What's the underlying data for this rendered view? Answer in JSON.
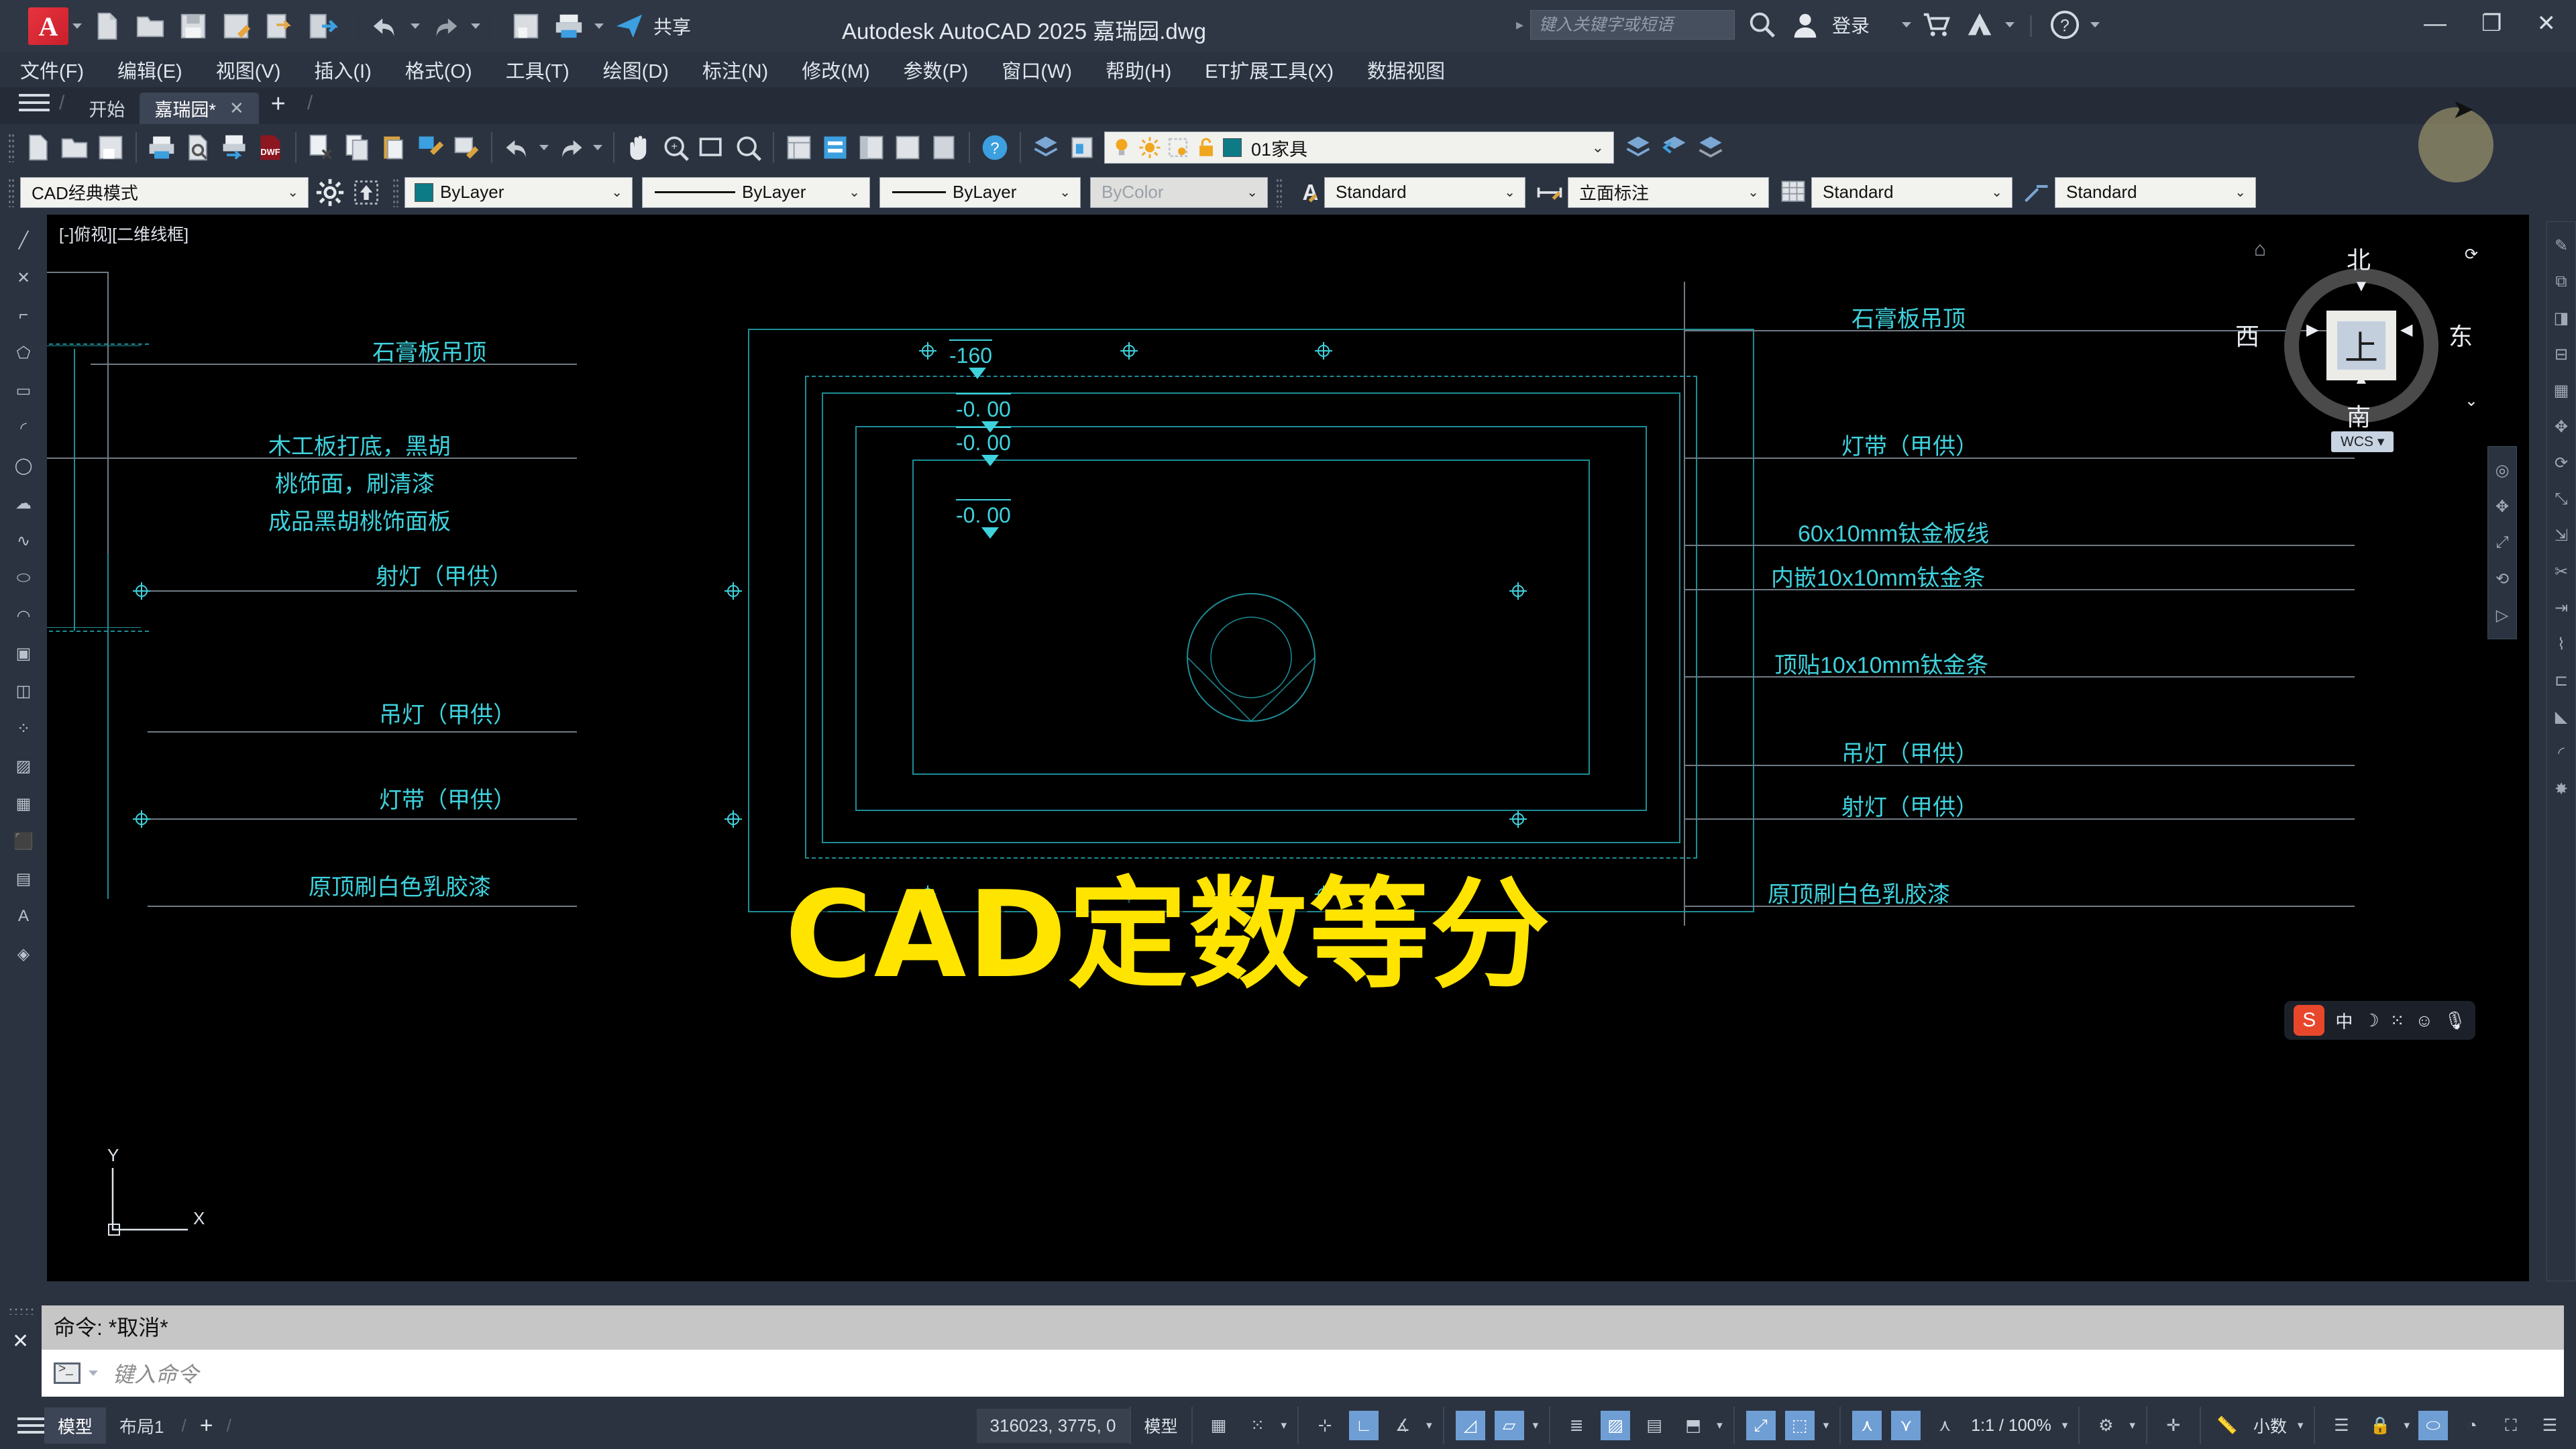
{
  "titlebar": {
    "app_logo": "autocad-A-logo",
    "title": "Autodesk AutoCAD 2025   嘉瑞园.dwg",
    "search_placeholder": "键入关键字或短语",
    "login_label": "登录",
    "quick_access_icons": [
      "new-file-icon",
      "open-folder-icon",
      "save-icon",
      "save-as-icon",
      "export-icon",
      "undo-icon",
      "redo-icon",
      "save-alt-icon",
      "print-icon",
      "share-icon"
    ],
    "share_label": "共享",
    "window_buttons": [
      "minimize",
      "restore",
      "close"
    ]
  },
  "menubar": {
    "items": [
      {
        "label": "文件(F)"
      },
      {
        "label": "编辑(E)"
      },
      {
        "label": "视图(V)"
      },
      {
        "label": "插入(I)"
      },
      {
        "label": "格式(O)"
      },
      {
        "label": "工具(T)"
      },
      {
        "label": "绘图(D)"
      },
      {
        "label": "标注(N)"
      },
      {
        "label": "修改(M)"
      },
      {
        "label": "参数(P)"
      },
      {
        "label": "窗口(W)"
      },
      {
        "label": "帮助(H)"
      },
      {
        "label": "ET扩展工具(X)"
      },
      {
        "label": "数据视图"
      }
    ]
  },
  "tabs": {
    "start_tab": "开始",
    "file_tab": "嘉瑞园*",
    "close_glyph": "✕",
    "plus_glyph": "+"
  },
  "toolbar": {
    "layer_name": "01家具",
    "layer_dropdown_glyph": "⌄"
  },
  "properties": {
    "workspace": "CAD经典模式",
    "color": "ByLayer",
    "linetype": "ByLayer",
    "lineweight": "ByLayer",
    "transparency": "ByColor",
    "text_style": "Standard",
    "dim_style": "立面标注",
    "table_style": "Standard",
    "multileader_style": "Standard"
  },
  "canvas": {
    "viewport_label": "[-]俯视][二维线框]",
    "watermark": "CAD定数等分",
    "left_annotations": [
      "石膏板吊顶",
      "木工板打底，黑胡",
      "桃饰面，刷清漆",
      "成品黑胡桃饰面板",
      "射灯（甲供）",
      "吊灯（甲供）",
      "灯带（甲供）",
      "原顶刷白色乳胶漆"
    ],
    "right_annotations": [
      "石膏板吊顶",
      "灯带（甲供）",
      "60x10mm钛金板线",
      "内嵌10x10mm钛金条",
      "顶贴10x10mm钛金条",
      "吊灯（甲供）",
      "射灯（甲供）",
      "原顶刷白色乳胶漆"
    ],
    "elevations": [
      "-160",
      "-0. 00",
      "-0. 00",
      "-0. 00"
    ],
    "viewcube": {
      "north": "北",
      "south": "南",
      "west": "西",
      "east": "东",
      "top_face": "上",
      "ucs_label": "WCS",
      "home_icon": "home-icon"
    },
    "ucs_axis": {
      "y": "Y",
      "x": "X"
    }
  },
  "commandline": {
    "history": "命令: *取消*",
    "placeholder": "键入命令"
  },
  "statusbar": {
    "model_tab": "模型",
    "layout_tab": "布局1",
    "plus_glyph": "+",
    "coordinates": "316023, 3775, 0",
    "space_label": "模型",
    "scale": "1:1 / 100%",
    "units": "小数",
    "toggles": [
      {
        "name": "grid-display",
        "on": false
      },
      {
        "name": "snap-mode",
        "on": false
      },
      {
        "name": "infer-constraints",
        "on": false
      },
      {
        "name": "ortho-mode",
        "on": true
      },
      {
        "name": "polar-tracking",
        "on": false
      },
      {
        "name": "isometric-drafting",
        "on": true
      },
      {
        "name": "object-snap-tracking",
        "on": true
      },
      {
        "name": "annotation-visibility",
        "on": true
      },
      {
        "name": "autoscale",
        "on": true
      },
      {
        "name": "workspace-switching",
        "on": false
      },
      {
        "name": "clean-screen",
        "on": false
      }
    ]
  },
  "ime": {
    "logo": "S",
    "mode": "中",
    "icons": [
      "moon-icon",
      "dots-icon",
      "emoji-icon",
      "mic-icon"
    ]
  },
  "colors": {
    "accent_cyan": "#3fd2dd",
    "watermark_yellow": "#ffe400",
    "brand_red": "#e8333f",
    "toggle_blue": "#6f9ed4",
    "chrome_dark": "#2b3340",
    "canvas_black": "#000000"
  }
}
